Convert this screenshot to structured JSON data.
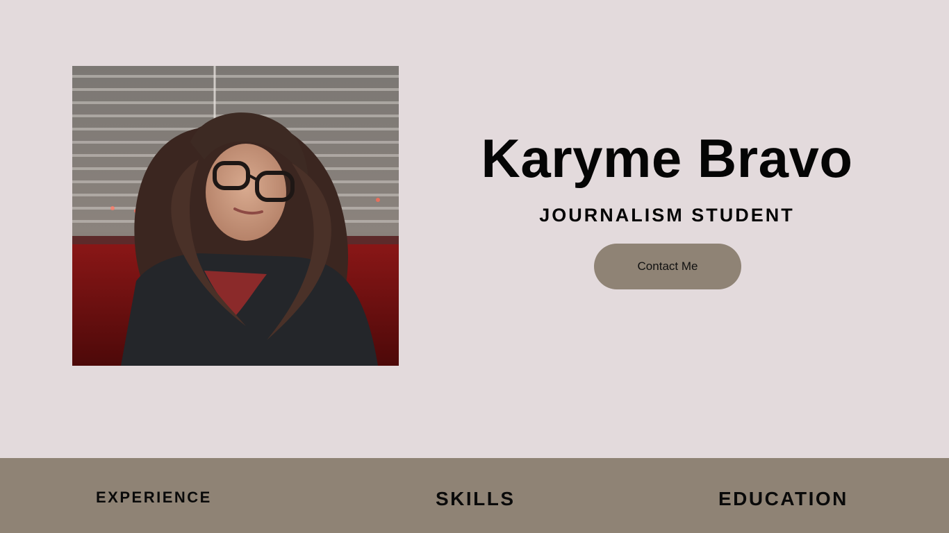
{
  "hero": {
    "name": "Karyme Bravo",
    "role": "JOURNALISM STUDENT",
    "contact_label": "Contact Me"
  },
  "nav": {
    "experience_label": "EXPERIENCE",
    "skills_label": "SKILLS",
    "education_label": "EDUCATION"
  },
  "colors": {
    "background": "#e3dadc",
    "accent": "#8f8375",
    "text": "#050505"
  },
  "photo": {
    "icon": "portrait-photo"
  }
}
